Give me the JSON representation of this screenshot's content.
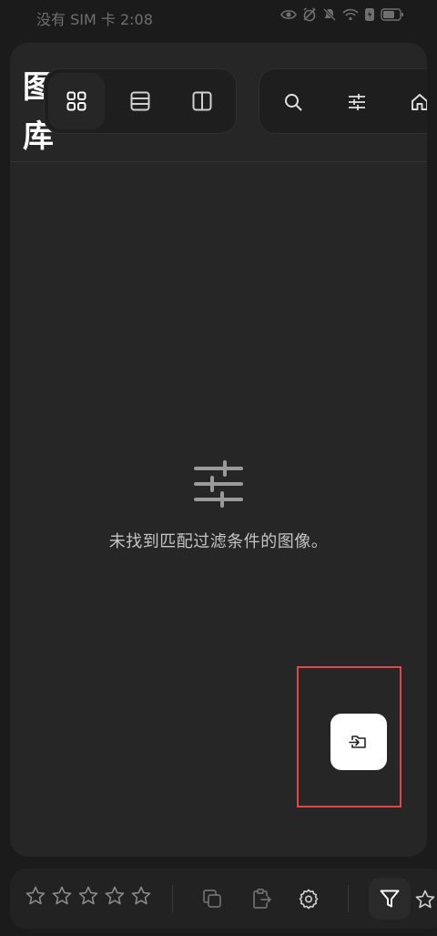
{
  "status_bar": {
    "text": "没有 SIM 卡 2:08",
    "icons": [
      "eye-icon",
      "alarm-off-icon",
      "mute-icon",
      "wifi-icon",
      "battery-saver-icon",
      "battery-icon"
    ]
  },
  "header": {
    "title": "图库",
    "view_modes": [
      "grid-view-icon",
      "list-view-icon",
      "split-view-icon"
    ],
    "active_view": "grid-view-icon",
    "tools": [
      "search-icon",
      "sliders-icon",
      "home-icon"
    ]
  },
  "empty_state": {
    "icon": "sliders-icon",
    "message": "未找到匹配过滤条件的图像。"
  },
  "fab": {
    "icon": "import-folder-icon"
  },
  "bottom_bar": {
    "rating_icons": [
      "star-icon",
      "star-icon",
      "star-icon",
      "star-icon",
      "star-icon"
    ],
    "actions": [
      "copy-icon",
      "paste-icon",
      "settings-icon"
    ],
    "filter_icon": "filter-icon",
    "trailing_icon": "star-icon"
  },
  "colors": {
    "background": "#1b1b1b",
    "panel": "#262626",
    "highlight": "#e04848",
    "fab": "#ffffff"
  }
}
